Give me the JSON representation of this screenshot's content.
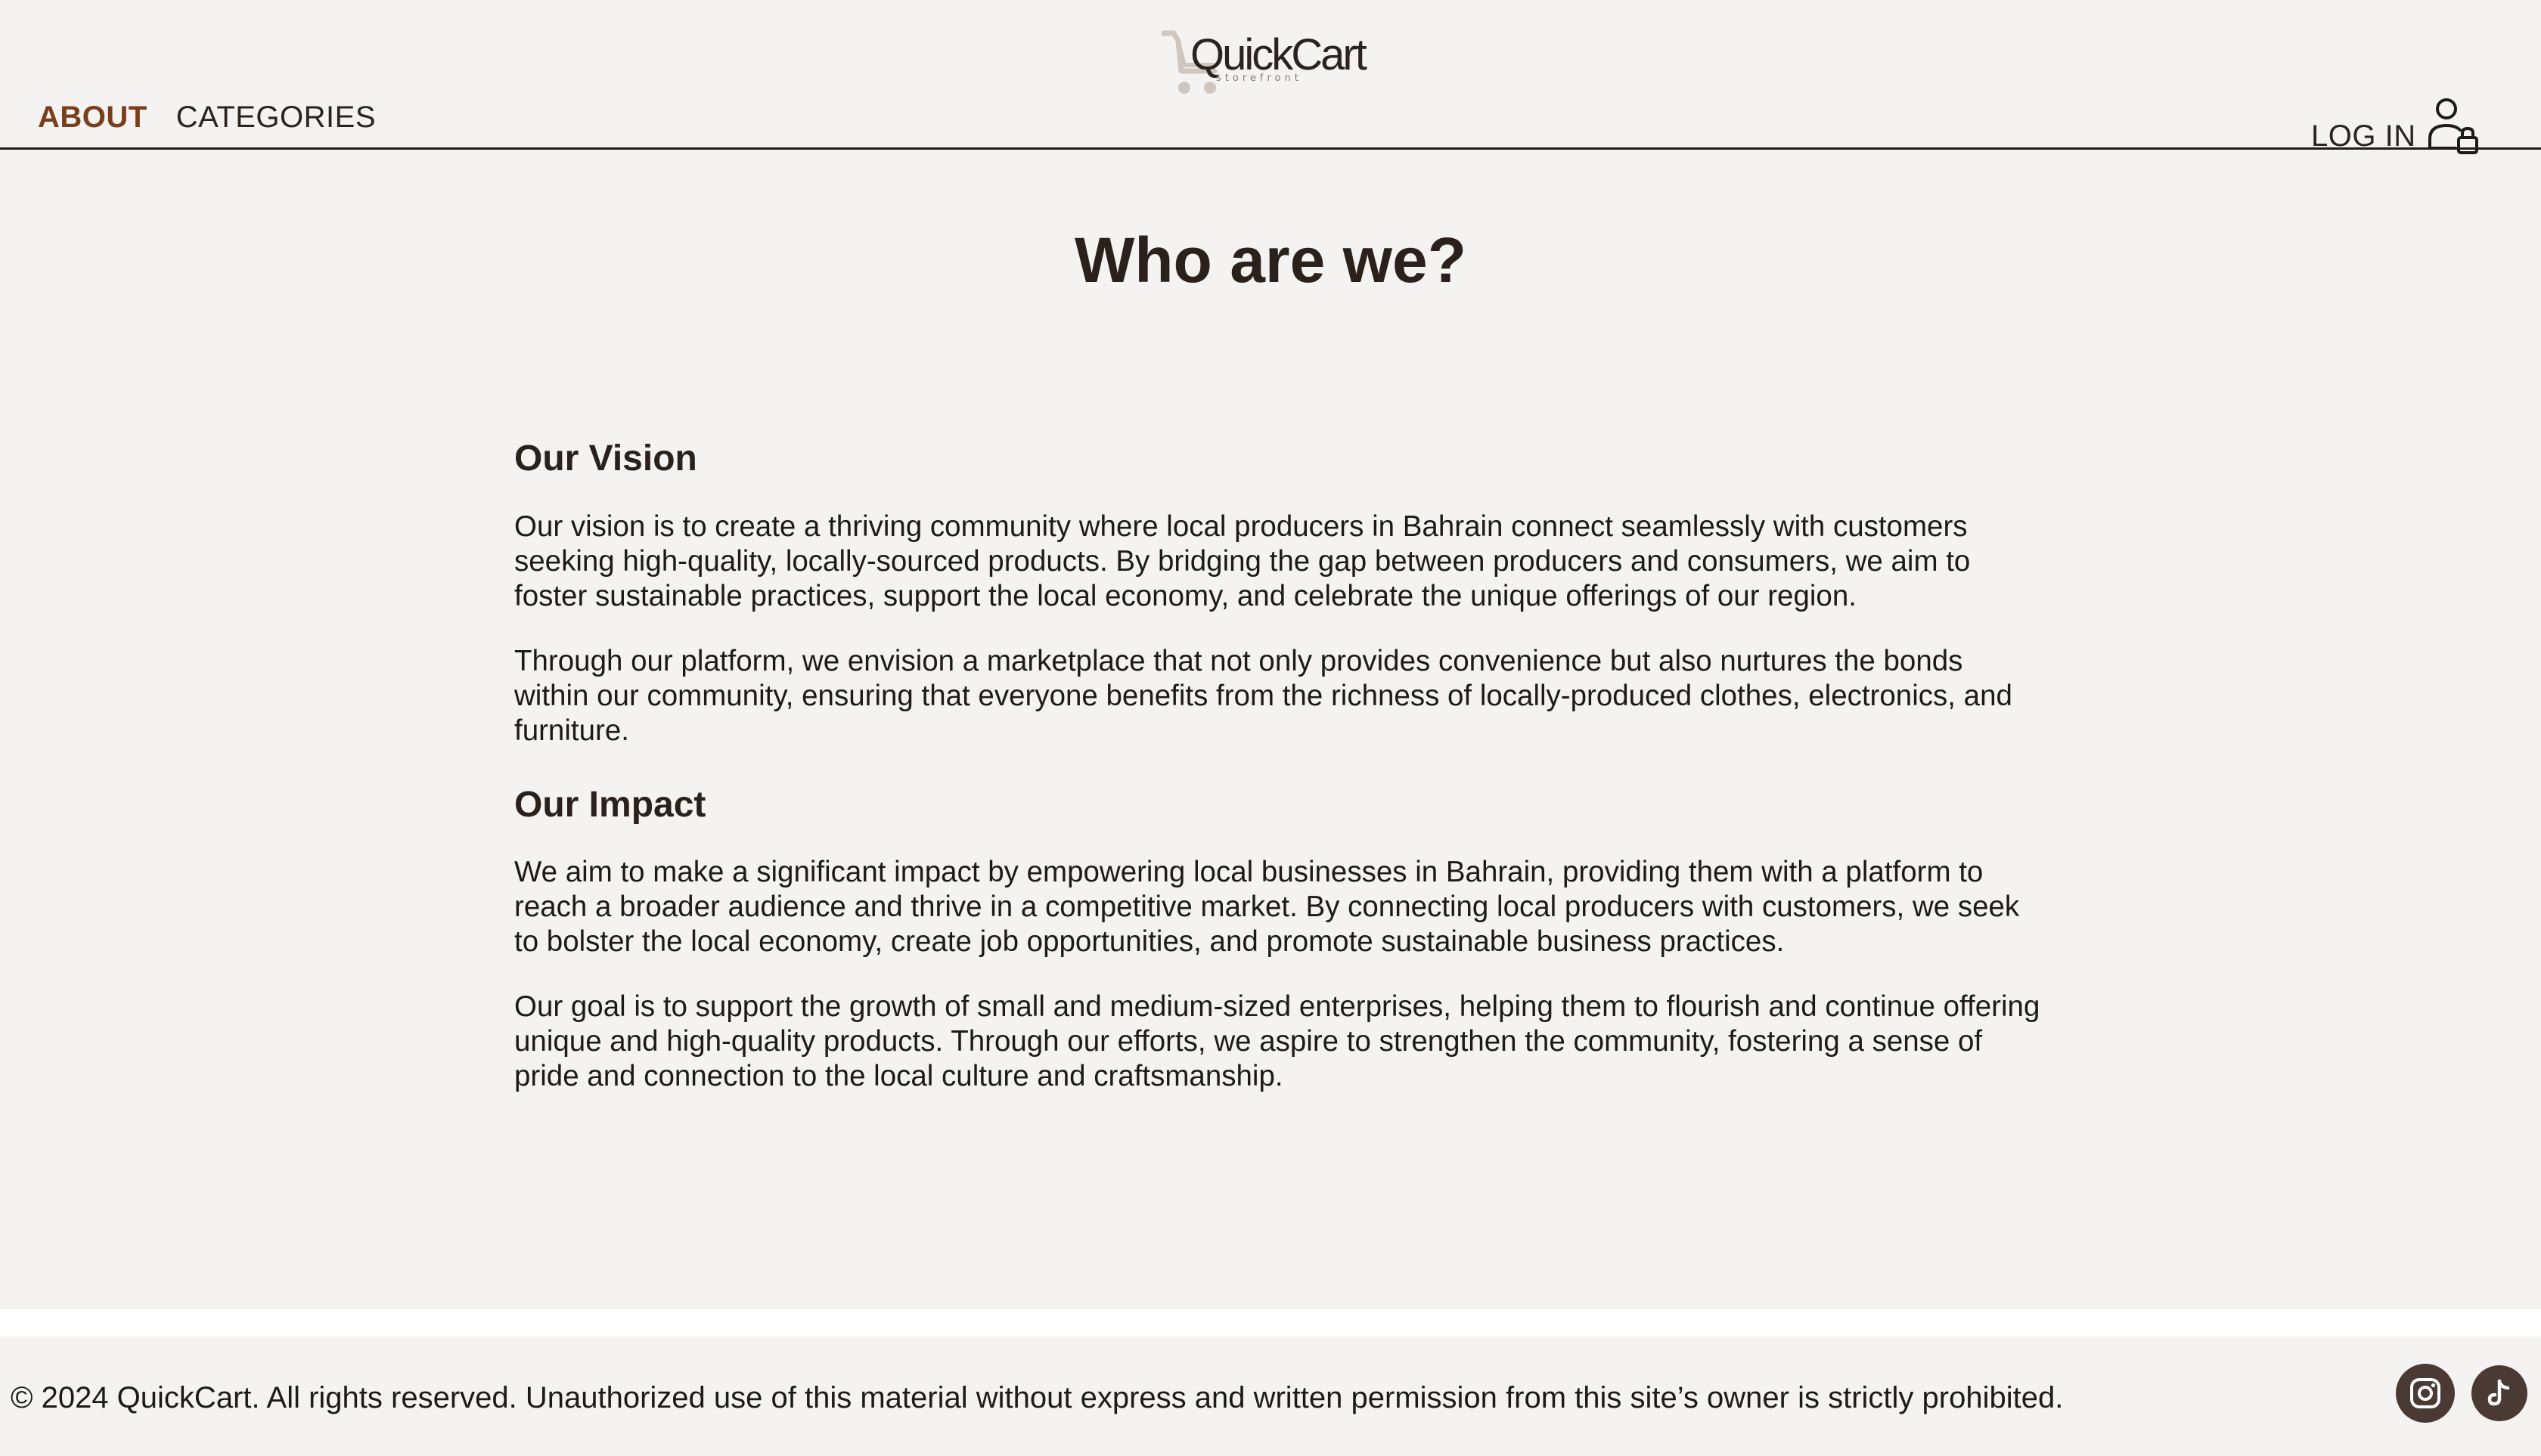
{
  "header": {
    "nav": {
      "about": "ABOUT",
      "categories": "CATEGORIES"
    },
    "logo": {
      "name": "QuickCart",
      "tagline": "storefront"
    },
    "login_label": "LOG IN",
    "login_icon": "user-lock-icon"
  },
  "main": {
    "title": "Who are we?",
    "sections": [
      {
        "heading": "Our Vision",
        "paragraphs": [
          "Our vision is to create a thriving community where local producers in Bahrain connect seamlessly with customers seeking high-quality, locally-sourced products. By bridging the gap between producers and consumers, we aim to foster sustainable practices, support the local economy, and celebrate the unique offerings of our region.",
          "Through our platform, we envision a marketplace that not only provides convenience but also nurtures the bonds within our community, ensuring that everyone benefits from the richness of locally-produced clothes, electronics, and furniture."
        ]
      },
      {
        "heading": "Our Impact",
        "paragraphs": [
          "We aim to make a significant impact by empowering local businesses in Bahrain, providing them with a platform to reach a broader audience and thrive in a competitive market. By connecting local producers with customers, we seek to bolster the local economy, create job opportunities, and promote sustainable business practices.",
          "Our goal is to support the growth of small and medium-sized enterprises, helping them to flourish and continue offering unique and high-quality products. Through our efforts, we aspire to strengthen the community, fostering a sense of pride and connection to the local culture and craftsmanship."
        ]
      }
    ]
  },
  "footer": {
    "copyright": "© 2024 QuickCart. All rights reserved. Unauthorized use of this material without express and written permission from this site’s owner is strictly prohibited.",
    "social": [
      "instagram-icon",
      "tiktok-icon"
    ]
  },
  "colors": {
    "background": "#f4f3f1",
    "accent": "#7a3f1a",
    "text": "#1e1a17",
    "social_bg": "#4a3a33",
    "logo_cart": "#cfc6c0"
  }
}
